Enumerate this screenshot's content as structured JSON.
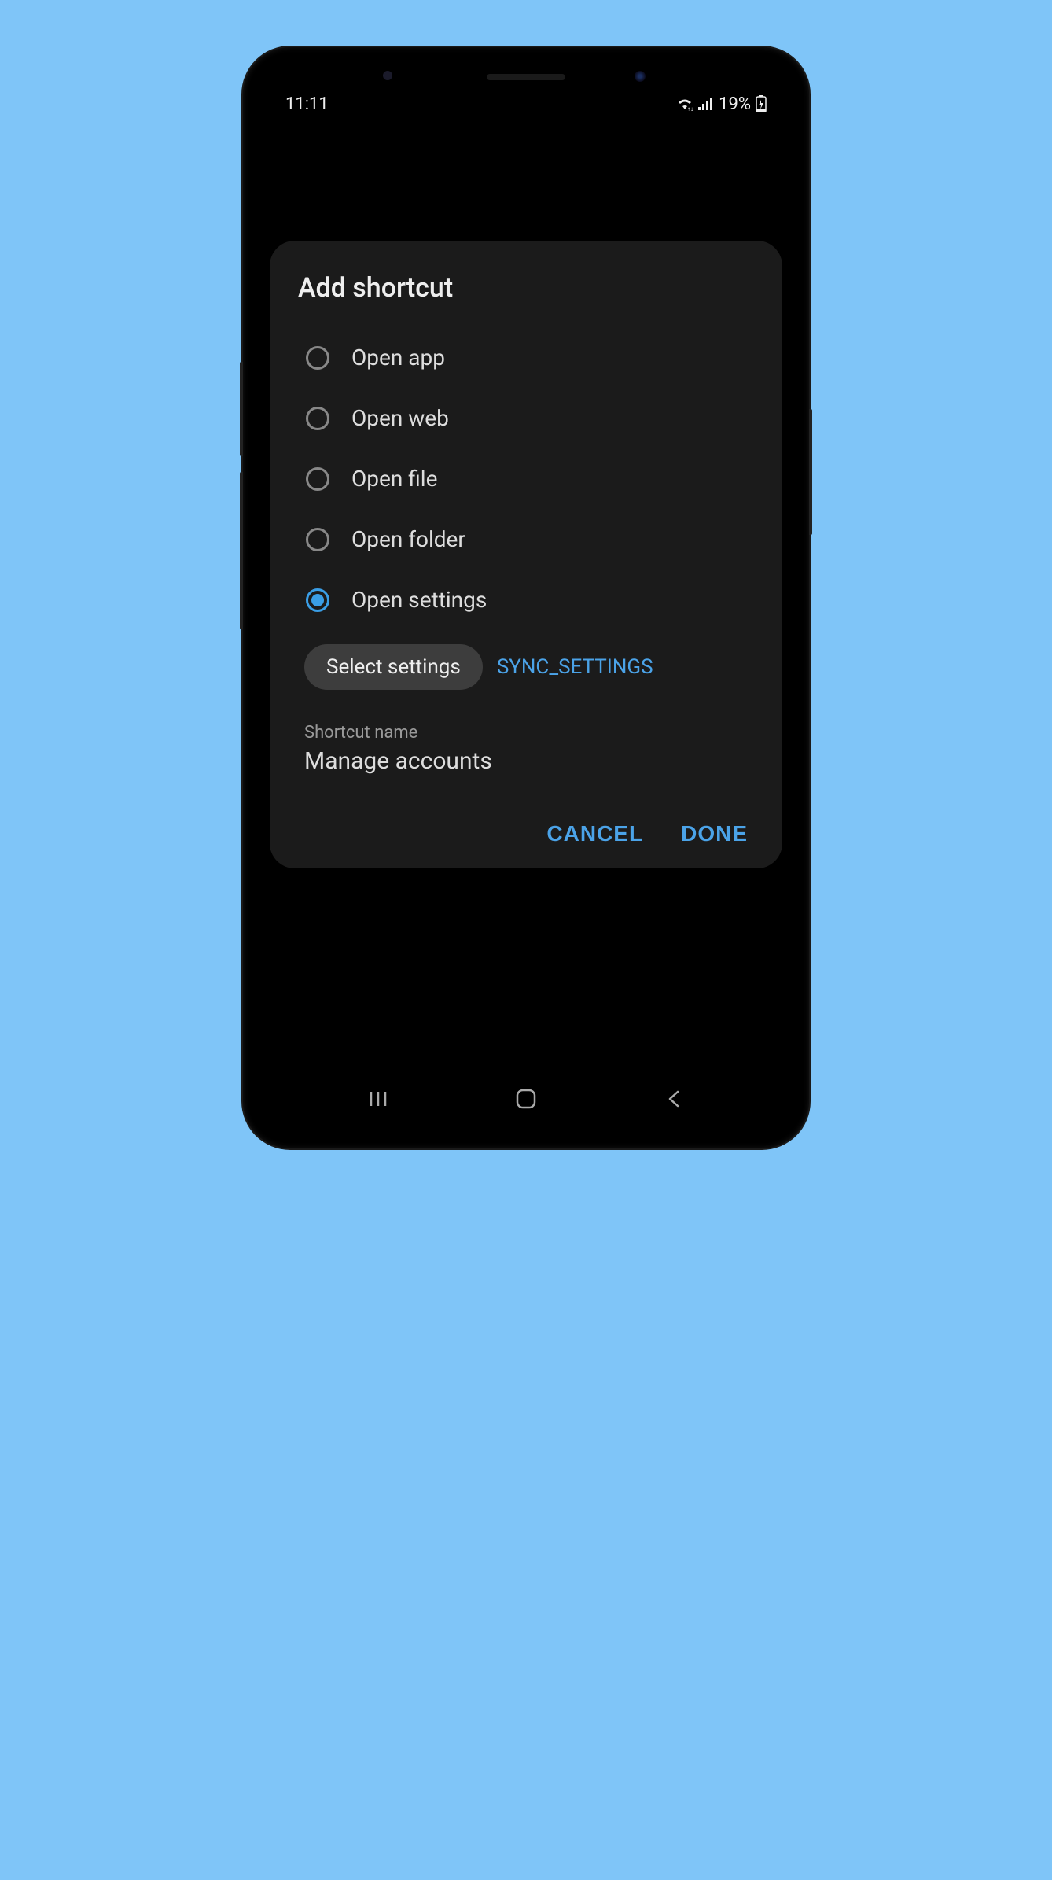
{
  "status_bar": {
    "time": "11:11",
    "battery_percent": "19%"
  },
  "dialog": {
    "title": "Add shortcut",
    "options": [
      {
        "label": "Open app",
        "selected": false
      },
      {
        "label": "Open web",
        "selected": false
      },
      {
        "label": "Open file",
        "selected": false
      },
      {
        "label": "Open folder",
        "selected": false
      },
      {
        "label": "Open settings",
        "selected": true
      }
    ],
    "chip_label": "Select settings",
    "chip_value": "SYNC_SETTINGS",
    "input_label": "Shortcut name",
    "input_value": "Manage accounts",
    "actions": {
      "cancel": "CANCEL",
      "done": "DONE"
    }
  },
  "colors": {
    "accent": "#4ba3e8",
    "background": "#7fc5f8",
    "dialog_bg": "#1b1b1b"
  }
}
